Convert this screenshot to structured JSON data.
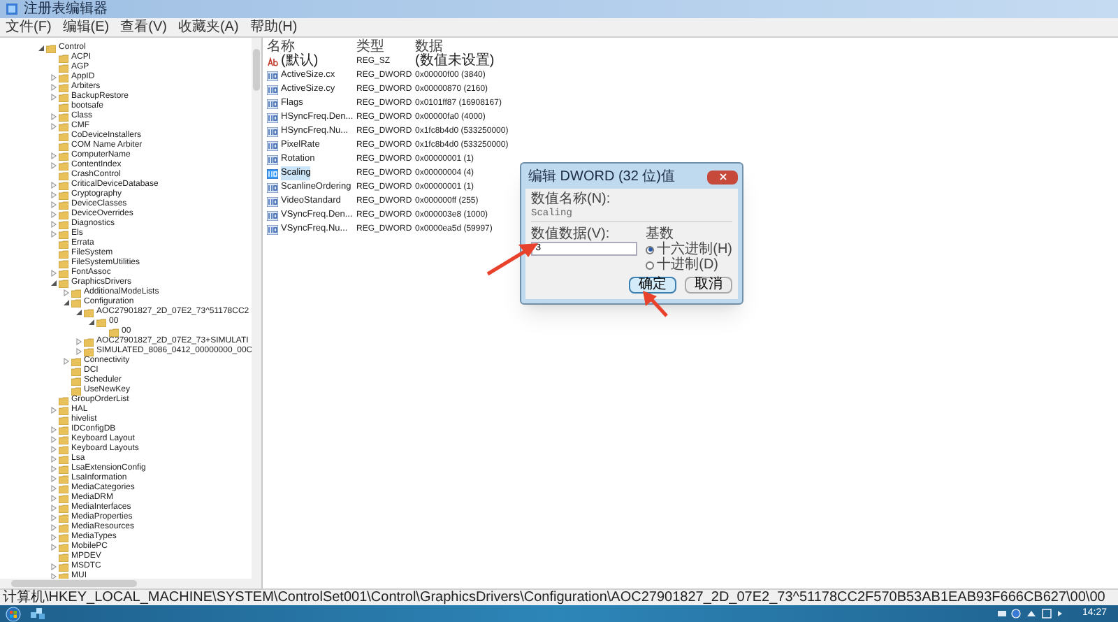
{
  "window": {
    "title": "注册表编辑器"
  },
  "menu": [
    "文件(F)",
    "编辑(E)",
    "查看(V)",
    "收藏夹(A)",
    "帮助(H)"
  ],
  "tree": [
    {
      "label": "Control",
      "expanded": true,
      "children": [
        {
          "label": "ACPI"
        },
        {
          "label": "AGP"
        },
        {
          "label": "AppID",
          "expanded": false
        },
        {
          "label": "Arbiters",
          "expanded": false
        },
        {
          "label": "BackupRestore",
          "expanded": false
        },
        {
          "label": "bootsafe"
        },
        {
          "label": "Class",
          "expanded": false
        },
        {
          "label": "CMF",
          "expanded": false
        },
        {
          "label": "CoDeviceInstallers"
        },
        {
          "label": "COM Name Arbiter"
        },
        {
          "label": "ComputerName",
          "expanded": false
        },
        {
          "label": "ContentIndex",
          "expanded": false
        },
        {
          "label": "CrashControl"
        },
        {
          "label": "CriticalDeviceDatabase",
          "expanded": false
        },
        {
          "label": "Cryptography",
          "expanded": false
        },
        {
          "label": "DeviceClasses",
          "expanded": false
        },
        {
          "label": "DeviceOverrides",
          "expanded": false
        },
        {
          "label": "Diagnostics",
          "expanded": false
        },
        {
          "label": "Els",
          "expanded": false
        },
        {
          "label": "Errata"
        },
        {
          "label": "FileSystem"
        },
        {
          "label": "FileSystemUtilities"
        },
        {
          "label": "FontAssoc",
          "expanded": false
        },
        {
          "label": "GraphicsDrivers",
          "expanded": true,
          "children": [
            {
              "label": "AdditionalModeLists",
              "expanded": false
            },
            {
              "label": "Configuration",
              "expanded": true,
              "children": [
                {
                  "label": "AOC27901827_2D_07E2_73^51178CC2",
                  "expanded": true,
                  "children": [
                    {
                      "label": "00",
                      "expanded": true,
                      "children": [
                        {
                          "label": "00"
                        }
                      ]
                    }
                  ]
                },
                {
                  "label": "AOC27901827_2D_07E2_73+SIMULATI",
                  "expanded": false
                },
                {
                  "label": "SIMULATED_8086_0412_00000000_00C",
                  "expanded": false
                }
              ]
            },
            {
              "label": "Connectivity",
              "expanded": false
            },
            {
              "label": "DCI"
            },
            {
              "label": "Scheduler"
            },
            {
              "label": "UseNewKey"
            }
          ]
        },
        {
          "label": "GroupOrderList"
        },
        {
          "label": "HAL",
          "expanded": false
        },
        {
          "label": "hivelist"
        },
        {
          "label": "IDConfigDB",
          "expanded": false
        },
        {
          "label": "Keyboard Layout",
          "expanded": false
        },
        {
          "label": "Keyboard Layouts",
          "expanded": false
        },
        {
          "label": "Lsa",
          "expanded": false
        },
        {
          "label": "LsaExtensionConfig",
          "expanded": false
        },
        {
          "label": "LsaInformation",
          "expanded": false
        },
        {
          "label": "MediaCategories",
          "expanded": false
        },
        {
          "label": "MediaDRM",
          "expanded": false
        },
        {
          "label": "MediaInterfaces",
          "expanded": false
        },
        {
          "label": "MediaProperties",
          "expanded": false
        },
        {
          "label": "MediaResources",
          "expanded": false
        },
        {
          "label": "MediaTypes",
          "expanded": false
        },
        {
          "label": "MobilePC",
          "expanded": false
        },
        {
          "label": "MPDEV"
        },
        {
          "label": "MSDTC",
          "expanded": false
        },
        {
          "label": "MUI",
          "expanded": false
        }
      ]
    }
  ],
  "values": {
    "columns": [
      "名称",
      "类型",
      "数据"
    ],
    "rows": [
      {
        "kind": "string",
        "name": "(默认)",
        "type": "REG_SZ",
        "data": "(数值未设置)",
        "selected": false
      },
      {
        "kind": "dword",
        "name": "ActiveSize.cx",
        "type": "REG_DWORD",
        "data": "0x00000f00 (3840)",
        "selected": false
      },
      {
        "kind": "dword",
        "name": "ActiveSize.cy",
        "type": "REG_DWORD",
        "data": "0x00000870 (2160)",
        "selected": false
      },
      {
        "kind": "dword",
        "name": "Flags",
        "type": "REG_DWORD",
        "data": "0x0101ff87 (16908167)",
        "selected": false
      },
      {
        "kind": "dword",
        "name": "HSyncFreq.Den...",
        "type": "REG_DWORD",
        "data": "0x00000fa0 (4000)",
        "selected": false
      },
      {
        "kind": "dword",
        "name": "HSyncFreq.Nu...",
        "type": "REG_DWORD",
        "data": "0x1fc8b4d0 (533250000)",
        "selected": false
      },
      {
        "kind": "dword",
        "name": "PixelRate",
        "type": "REG_DWORD",
        "data": "0x1fc8b4d0 (533250000)",
        "selected": false
      },
      {
        "kind": "dword",
        "name": "Rotation",
        "type": "REG_DWORD",
        "data": "0x00000001 (1)",
        "selected": false
      },
      {
        "kind": "dword",
        "name": "Scaling",
        "type": "REG_DWORD",
        "data": "0x00000004 (4)",
        "selected": true
      },
      {
        "kind": "dword",
        "name": "ScanlineOrdering",
        "type": "REG_DWORD",
        "data": "0x00000001 (1)",
        "selected": false
      },
      {
        "kind": "dword",
        "name": "VideoStandard",
        "type": "REG_DWORD",
        "data": "0x000000ff (255)",
        "selected": false
      },
      {
        "kind": "dword",
        "name": "VSyncFreq.Den...",
        "type": "REG_DWORD",
        "data": "0x000003e8 (1000)",
        "selected": false
      },
      {
        "kind": "dword",
        "name": "VSyncFreq.Nu...",
        "type": "REG_DWORD",
        "data": "0x0000ea5d (59997)",
        "selected": false
      }
    ]
  },
  "dialog": {
    "title": "编辑 DWORD (32 位)值",
    "name_label": "数值名称(N):",
    "name_value": "Scaling",
    "data_label": "数值数据(V):",
    "data_value": "3",
    "base_label": "基数",
    "radios": [
      {
        "label": "十六进制(H)",
        "selected": true
      },
      {
        "label": "十进制(D)",
        "selected": false
      }
    ],
    "buttons": [
      "确定",
      "取消"
    ]
  },
  "status_bar": "计算机\\HKEY_LOCAL_MACHINE\\SYSTEM\\ControlSet001\\Control\\GraphicsDrivers\\Configuration\\AOC27901827_2D_07E2_73^51178CC2F570B53AB1EAB93F666CB627\\00\\00",
  "taskbar": {
    "time": "14:27"
  }
}
